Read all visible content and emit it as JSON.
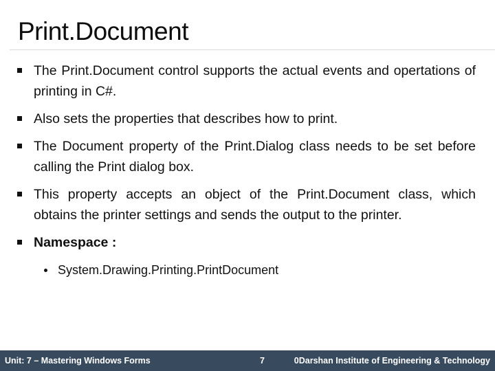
{
  "slide": {
    "title": "Print.Document",
    "bullets": [
      {
        "text": "The Print.Document control supports the actual events and opertations of printing in C#.",
        "bold": false
      },
      {
        "text": "Also sets the properties that describes how to print.",
        "bold": false
      },
      {
        "text": "The Document property of the Print.Dialog class needs to be set before calling the Print dialog box.",
        "bold": false
      },
      {
        "text": "This property accepts an object of the Print.Document class, which obtains the printer settings and sends the output to the printer.",
        "bold": false
      },
      {
        "text": "Namespace :",
        "bold": true
      }
    ],
    "sub_bullets": [
      {
        "text": "System.Drawing.Printing.PrintDocument"
      }
    ]
  },
  "footer": {
    "unit": "Unit: 7 – Mastering Windows Forms",
    "page": "7",
    "organization": "0Darshan Institute of Engineering & Technology",
    "background_color": "#384a5e"
  },
  "icons": {
    "bullet_marker": "square-bullet-icon",
    "sub_bullet_marker": "round-bullet-icon"
  }
}
